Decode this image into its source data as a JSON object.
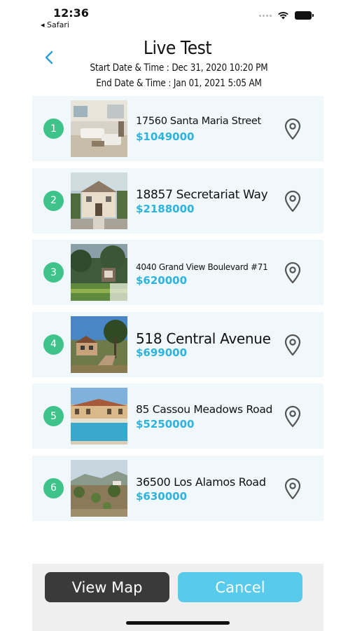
{
  "status_bar": {
    "time": "12:36",
    "back_app": "◂ Safari"
  },
  "header": {
    "title": "Live Test",
    "start": "Start Date & Time :  Dec 31, 2020  10:20 PM",
    "end": "End Date & Time :  Jan 01, 2021  5:05 AM"
  },
  "accent_colors": {
    "number_badge": "#3fc38b",
    "price": "#2cb3de",
    "cancel": "#58cbec",
    "view_map": "#3a3a3a"
  },
  "listings": [
    {
      "num": "1",
      "address": "17560 Santa Maria Street",
      "price": "$1049000",
      "photo": "living-room-photo"
    },
    {
      "num": "2",
      "address": "18857 Secretariat Way",
      "price": "$2188000",
      "photo": "house-exterior-photo"
    },
    {
      "num": "3",
      "address": "4040 Grand View Boulevard #71",
      "price": "$620000",
      "photo": "building-garden-photo"
    },
    {
      "num": "4",
      "address": "518 Central Avenue",
      "price": "$699000",
      "photo": "hillside-home-photo"
    },
    {
      "num": "5",
      "address": "85 Cassou Meadows Road",
      "price": "$5250000",
      "photo": "pool-estate-photo"
    },
    {
      "num": "6",
      "address": "36500 Los Alamos Road",
      "price": "$630000",
      "photo": "desert-lot-photo"
    }
  ],
  "buttons": {
    "view_map": "View Map",
    "cancel": "Cancel"
  }
}
